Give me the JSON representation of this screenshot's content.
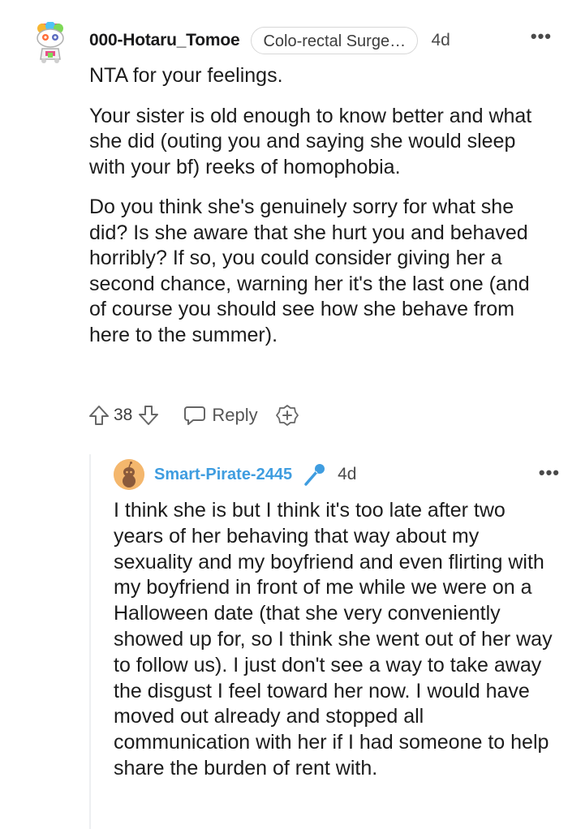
{
  "comment": {
    "username": "000-Hotaru_Tomoe",
    "flair": "Colo-rectal Surgeo...",
    "time": "4d",
    "more": "•••",
    "paragraphs": [
      "NTA for your feelings.",
      "Your sister is old enough to know better and what she did (outing you and saying she would sleep with your bf) reeks of homophobia.",
      "Do you think she's genuinely sorry for what she did? Is she aware that she hurt you and behaved horribly? If so, you could consider giving her a second chance, warning her it's the last one (and of course you should see how she behave from here to the summer)."
    ],
    "score": "38",
    "reply_label": "Reply",
    "icons": [
      "snoo-avatar-icon",
      "upvote-icon",
      "downvote-icon",
      "reply-bubble-icon",
      "award-plus-icon",
      "more-options-icon"
    ]
  },
  "reply": {
    "username": "Smart-Pirate-2445",
    "time": "4d",
    "more": "•••",
    "text": "I think she is but I think it's too late after two years of her behaving that way about my sexuality and my boyfriend and even flirting with my boyfriend in front of me while we were on a Halloween date (that she very conveniently showed up for, so I think she went out of her way to follow us). I just don't see a way to take away the disgust I feel toward her now. I would have moved out already and stopped all communication with her if I had someone to help share the burden of rent with.",
    "icons": [
      "user-avatar-icon",
      "microphone-icon",
      "more-options-icon"
    ]
  },
  "colors": {
    "reply_username": "#3f9de0",
    "thread_line": "#edeff1",
    "text": "#1c1c1c"
  }
}
